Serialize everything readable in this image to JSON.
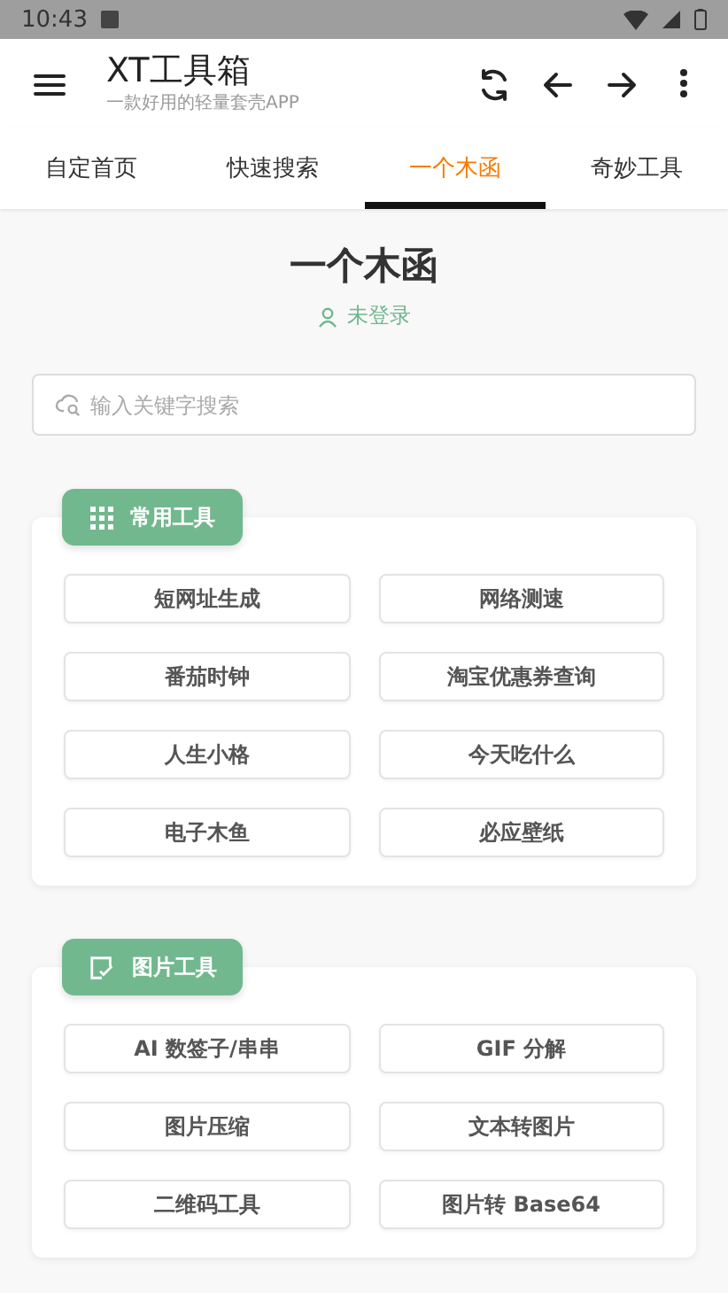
{
  "status_bar": {
    "time": "10:43"
  },
  "app_bar": {
    "title": "XT工具箱",
    "subtitle": "一款好用的轻量套壳APP"
  },
  "tabs": [
    {
      "label": "自定首页",
      "selected": false
    },
    {
      "label": "快速搜索",
      "selected": false
    },
    {
      "label": "一个木函",
      "selected": true
    },
    {
      "label": "奇妙工具",
      "selected": false
    }
  ],
  "header": {
    "title": "一个木函",
    "login": "未登录"
  },
  "search": {
    "placeholder": "输入关键字搜索"
  },
  "sections": [
    {
      "kind": "grid",
      "title": "常用工具",
      "tools": [
        "短网址生成",
        "网络测速",
        "番茄时钟",
        "淘宝优惠券查询",
        "人生小格",
        "今天吃什么",
        "电子木鱼",
        "必应壁纸"
      ]
    },
    {
      "kind": "image",
      "title": "图片工具",
      "tools": [
        "AI 数签子/串串",
        "GIF 分解",
        "图片压缩",
        "文本转图片",
        "二维码工具",
        "图片转 Base64"
      ]
    }
  ]
}
